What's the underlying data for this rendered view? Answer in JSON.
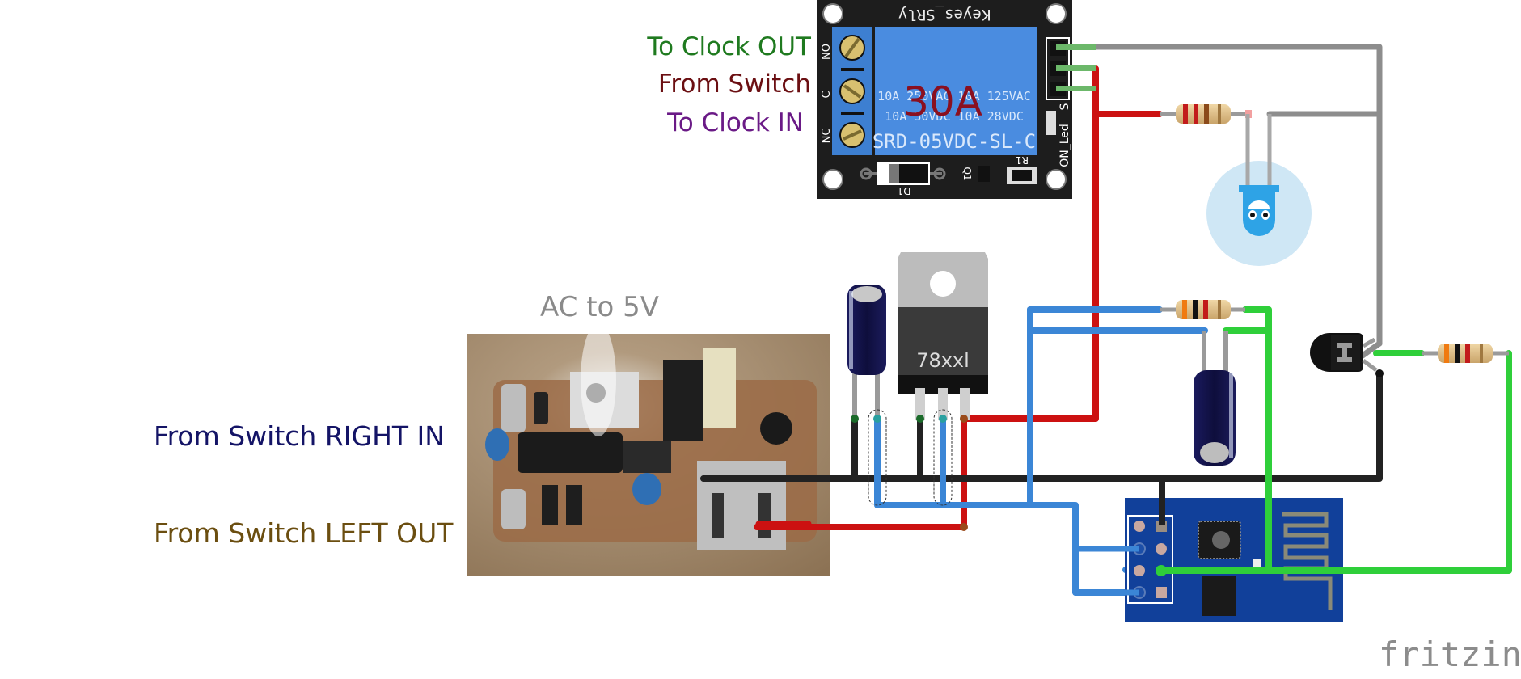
{
  "labels": {
    "relay_no": "To Clock OUT",
    "relay_c": "From Switch",
    "relay_nc": "To Clock IN",
    "psu_title": "AC to 5V",
    "psu_in": "From Switch RIGHT IN",
    "psu_out": "From Switch LEFT OUT",
    "watermark": "fritzing"
  },
  "label_colors": {
    "relay_no": "#1f7a1f",
    "relay_c": "#6b0f12",
    "relay_nc": "#6a1a86",
    "psu_title": "#8a8a8a",
    "psu_in": "#141466",
    "psu_out": "#6b4e10",
    "watermark": "#8c8c8c"
  },
  "relay": {
    "brand": "Keyes_SRly",
    "rating_overlay": "30A",
    "spec_line1": "10A 250VAC 10A 125VAC",
    "spec_line2": "10A 30VDC 10A 28VDC",
    "model": "SRD-05VDC-SL-C",
    "terminals": [
      "NO",
      "C",
      "NC"
    ],
    "side_label": "ON_Led",
    "pin_label": "S",
    "diode_label": "D1",
    "transistor_label": "Q1",
    "resistor_label": "R1"
  },
  "regulator": {
    "label": "78xxl"
  },
  "wire_colors": {
    "red": "#cc1111",
    "black": "#222222",
    "blue": "#3b86d6",
    "green": "#2fcf3a",
    "gray": "#8d8d8d"
  }
}
